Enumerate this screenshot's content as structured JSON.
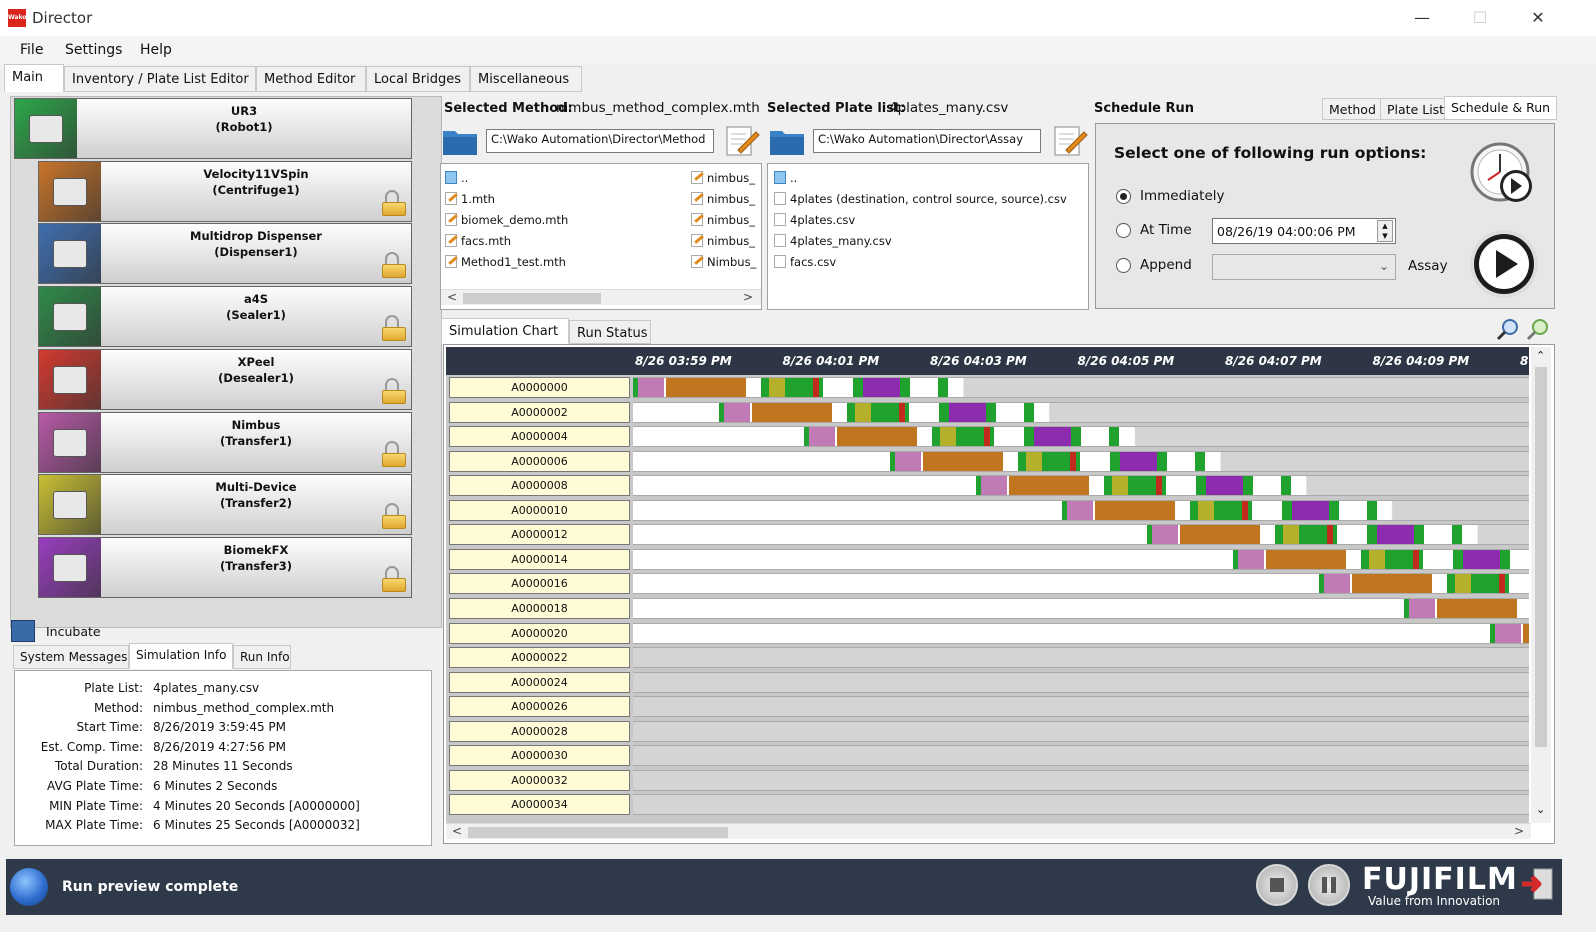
{
  "window": {
    "logo_text": "Wako",
    "title": "Director",
    "minimize": "—",
    "maximize": "☐",
    "close": "✕"
  },
  "menu": [
    "File",
    "Settings",
    "Help"
  ],
  "main_tabs": [
    "Main",
    "Inventory / Plate List Editor",
    "Method Editor",
    "Local Bridges",
    "Miscellaneous"
  ],
  "devices": [
    {
      "name": "UR3",
      "role": "(Robot1)",
      "color": "#2da84a"
    },
    {
      "name": "Velocity11VSpin",
      "role": "(Centrifuge1)",
      "color": "#c8742a"
    },
    {
      "name": "Multidrop Dispenser",
      "role": "(Dispenser1)",
      "color": "#3f6fb0"
    },
    {
      "name": "a4S",
      "role": "(Sealer1)",
      "color": "#2f8a4a"
    },
    {
      "name": "XPeel",
      "role": "(Desealer1)",
      "color": "#d23a30"
    },
    {
      "name": "Nimbus",
      "role": "(Transfer1)",
      "color": "#b85aa8"
    },
    {
      "name": "Multi-Device",
      "role": "(Transfer2)",
      "color": "#c9c035"
    },
    {
      "name": "BiomekFX",
      "role": "(Transfer3)",
      "color": "#9a3ec0"
    }
  ],
  "incubate_label": "Incubate",
  "info_tabs": [
    "System Messages",
    "Simulation Info",
    "Run Info"
  ],
  "sim_info": [
    {
      "k": "Plate List:",
      "v": "4plates_many.csv"
    },
    {
      "k": "Method:",
      "v": "nimbus_method_complex.mth"
    },
    {
      "k": "Start Time:",
      "v": "8/26/2019 3:59:45 PM"
    },
    {
      "k": "Est. Comp. Time:",
      "v": "8/26/2019 4:27:56 PM"
    },
    {
      "k": "Total Duration:",
      "v": "28 Minutes 11 Seconds"
    },
    {
      "k": "AVG Plate Time:",
      "v": "6 Minutes 2 Seconds"
    },
    {
      "k": "MIN Plate Time:",
      "v": "4 Minutes 20 Seconds [A0000000]"
    },
    {
      "k": "MAX Plate Time:",
      "v": "6 Minutes 25 Seconds [A0000032]"
    }
  ],
  "method": {
    "label": "Selected Method:",
    "value": "nimbus_method_complex.mth",
    "path": "C:\\Wako Automation\\Director\\Method",
    "files_col1": [
      "..",
      "1.mth",
      "biomek_demo.mth",
      "facs.mth",
      "Method1_test.mth"
    ],
    "files_col2": [
      "nimbus_",
      "nimbus_",
      "nimbus_",
      "nimbus_",
      "Nimbus_"
    ]
  },
  "platelist": {
    "label": "Selected Plate list:",
    "value": "4plates_many.csv",
    "path": "C:\\Wako Automation\\Director\\Assay",
    "files": [
      "..",
      "4plates (destination, control source, source).csv",
      "4plates.csv",
      "4plates_many.csv",
      "facs.csv"
    ]
  },
  "schedule": {
    "heading": "Schedule Run",
    "tabs": [
      "Method",
      "Plate List",
      "Schedule & Run"
    ],
    "prompt": "Select one of following run options:",
    "options": [
      "Immediately",
      "At Time",
      "Append"
    ],
    "selected": "Immediately",
    "time_value": "08/26/19 04:00:06 PM",
    "assay_label": "Assay"
  },
  "chart_tabs": [
    "Simulation Chart",
    "Run Status"
  ],
  "chart_data": {
    "type": "gantt",
    "time_labels": [
      "8/26 03:59 PM",
      "8/26 04:01 PM",
      "8/26 04:03 PM",
      "8/26 04:05 PM",
      "8/26 04:07 PM",
      "8/26 04:09 PM",
      "8"
    ],
    "colors": {
      "green": "#1fa22e",
      "pink": "#c07ab6",
      "orange": "#c0751e",
      "olive": "#b5b02c",
      "red": "#c22a1e",
      "purple": "#8e2cb0"
    },
    "rows": [
      {
        "label": "A0000000",
        "offset": 0
      },
      {
        "label": "A0000002",
        "offset": 1
      },
      {
        "label": "A0000004",
        "offset": 2
      },
      {
        "label": "A0000006",
        "offset": 3
      },
      {
        "label": "A0000008",
        "offset": 4
      },
      {
        "label": "A0000010",
        "offset": 5
      },
      {
        "label": "A0000012",
        "offset": 6
      },
      {
        "label": "A0000014",
        "offset": 7
      },
      {
        "label": "A0000016",
        "offset": 8
      },
      {
        "label": "A0000018",
        "offset": 9
      },
      {
        "label": "A0000020",
        "offset": 10
      },
      {
        "label": "A0000022",
        "offset": 11
      },
      {
        "label": "A0000024",
        "offset": 12
      },
      {
        "label": "A0000026",
        "offset": 13
      },
      {
        "label": "A0000028",
        "offset": 14
      },
      {
        "label": "A0000030",
        "offset": 15
      },
      {
        "label": "A0000032",
        "offset": 16
      },
      {
        "label": "A0000034",
        "offset": 17
      }
    ]
  },
  "status": {
    "message": "Run preview complete",
    "brand": "FUJIFILM",
    "tagline": "Value from Innovation"
  }
}
